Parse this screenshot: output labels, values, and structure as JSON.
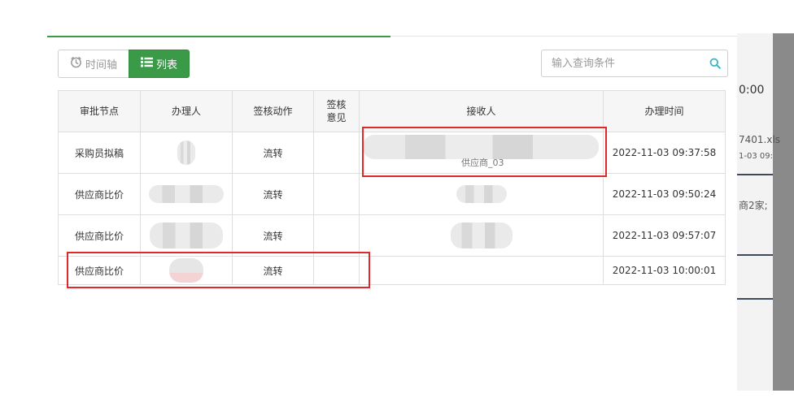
{
  "toolbar": {
    "timeline_label": "时间轴",
    "list_label": "列表"
  },
  "search": {
    "placeholder": "输入查询条件"
  },
  "table": {
    "headers": [
      "审批节点",
      "办理人",
      "签核动作",
      "签核意见",
      "接收人",
      "办理时间"
    ],
    "rows": [
      {
        "node": "采购员拟稿",
        "action": "流转",
        "opinion": "",
        "receiver_visible": "供应商_03",
        "time": "2022-11-03 09:37:58"
      },
      {
        "node": "供应商比价",
        "action": "流转",
        "opinion": "",
        "time": "2022-11-03 09:50:24"
      },
      {
        "node": "供应商比价",
        "action": "流转",
        "opinion": "",
        "time": "2022-11-03 09:57:07"
      },
      {
        "node": "供应商比价",
        "action": "流转",
        "opinion": "",
        "time": "2022-11-03 10:00:01"
      }
    ]
  },
  "background": {
    "time_fragment": "0:00",
    "file_fragment": "7401.xls",
    "date_fragment": "1-03 09:",
    "text_fragment": "商2家;"
  },
  "colors": {
    "accent_green": "#3a9a47",
    "annotation_red": "#e02a2a",
    "search_icon": "#3bb4c4"
  }
}
